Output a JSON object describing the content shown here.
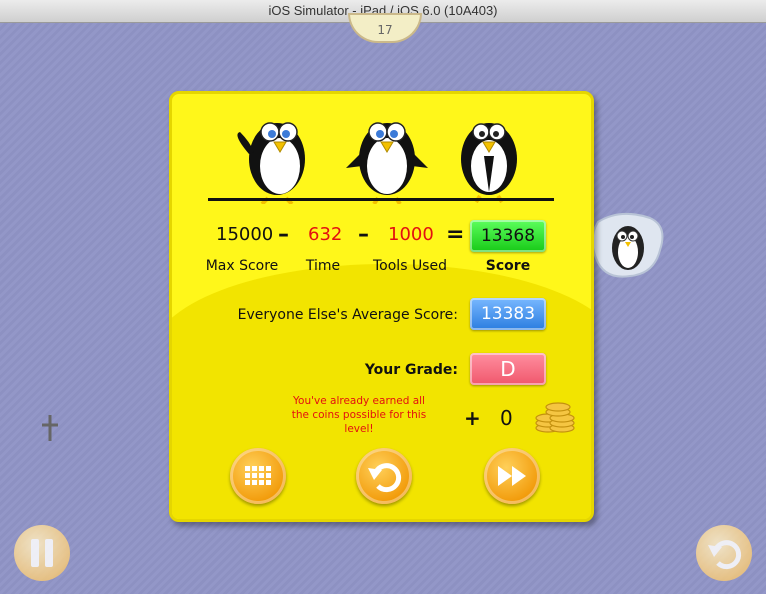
{
  "window": {
    "title": "iOS Simulator - iPad / iOS 6.0 (10A403)"
  },
  "level": {
    "number": "17"
  },
  "score": {
    "max_score": "15000",
    "max_score_label": "Max Score",
    "time": "632",
    "time_label": "Time",
    "tools_used": "1000",
    "tools_used_label": "Tools Used",
    "equals": "=",
    "minus": "–",
    "score": "13368",
    "score_label": "Score"
  },
  "average": {
    "label": "Everyone Else's Average Score:",
    "value": "13383"
  },
  "grade": {
    "label": "Your Grade:",
    "value": "D"
  },
  "coins": {
    "message": "You've already earned all the coins possible for this level!",
    "plus": "+",
    "earned": "0"
  },
  "buttons": {
    "level_menu": "grid-icon",
    "retry": "retry-icon",
    "next": "fast-forward-icon",
    "pause": "pause-icon",
    "restart": "restart-icon"
  },
  "colors": {
    "panel": "#fff71a",
    "score_box": "#2ee02e",
    "average_box": "#4a97f5",
    "grade_box": "#f56a7e",
    "time_value": "#e31010",
    "button_orange": "#f29b0a"
  }
}
